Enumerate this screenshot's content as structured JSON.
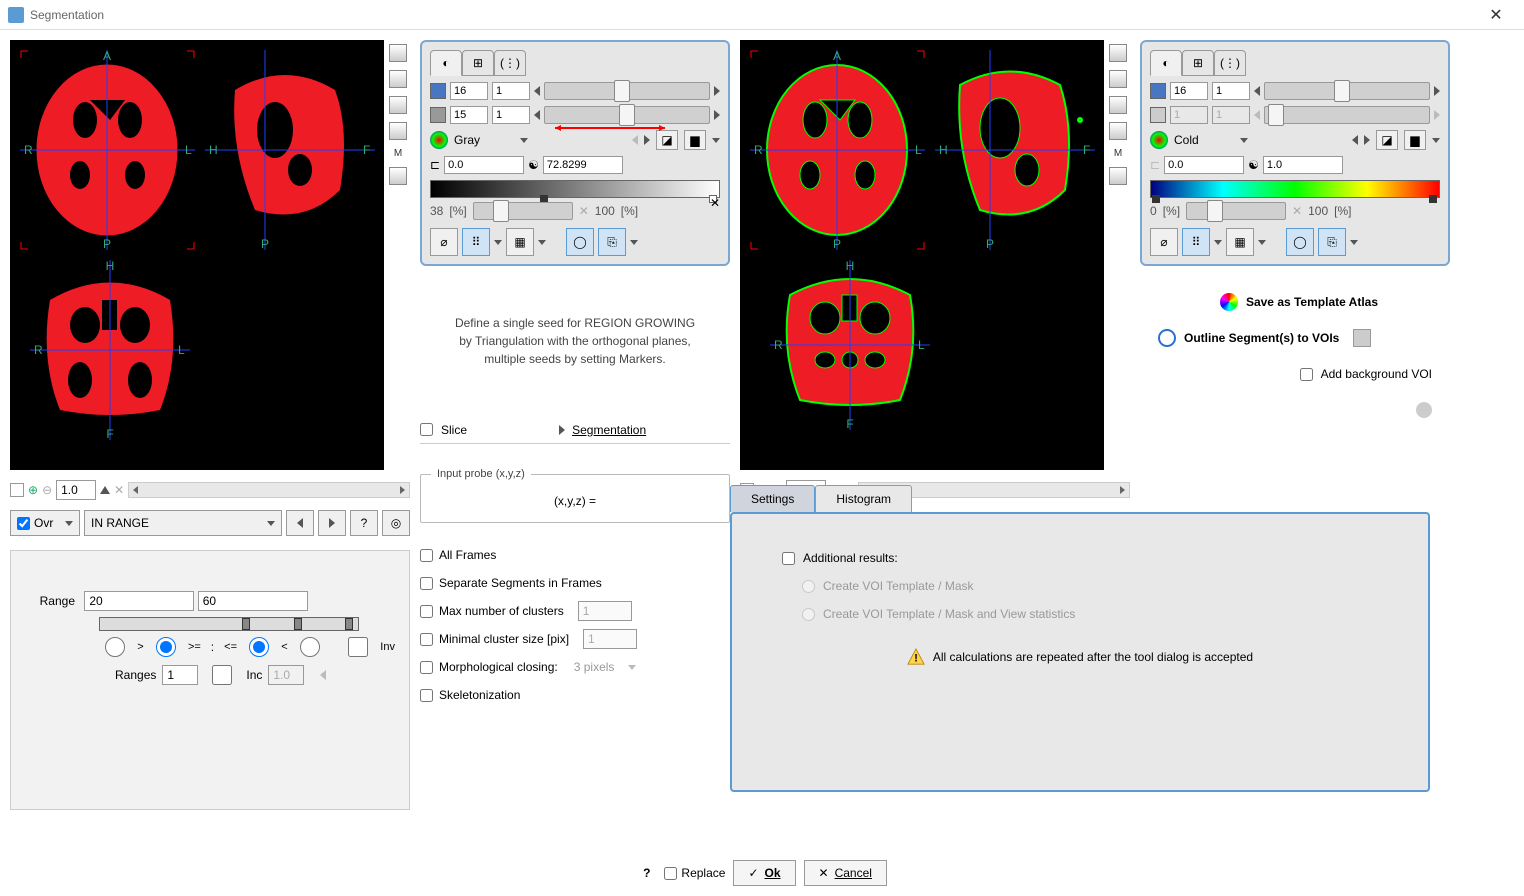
{
  "window": {
    "title": "Segmentation"
  },
  "panel_left": {
    "row1_a": "16",
    "row1_b": "1",
    "row2_a": "15",
    "row2_b": "1",
    "colormap": "Gray",
    "lo": "0.0",
    "hi": "72.8299",
    "pct_lo": "38",
    "pct_hi": "100",
    "pct_unit": "[%]"
  },
  "panel_right": {
    "row1_a": "16",
    "row1_b": "1",
    "row2_a": "1",
    "row2_b": "1",
    "colormap": "Cold",
    "lo": "0.0",
    "hi": "1.0",
    "pct_lo": "0",
    "pct_hi": "100",
    "pct_unit": "[%]"
  },
  "hint": {
    "line1": "Define a single seed for REGION GROWING",
    "line2": "by Triangulation with the orthogonal planes,",
    "line3": "multiple seeds by setting Markers."
  },
  "zoom": {
    "value": "1.0"
  },
  "ovr": {
    "label": "Ovr",
    "mode": "IN RANGE"
  },
  "range": {
    "label": "Range",
    "lo": "20",
    "hi": "60",
    "ranges_label": "Ranges",
    "count": "1",
    "inc_label": "Inc",
    "inc_value": "1.0",
    "inv_label": "Inv"
  },
  "slice": {
    "label": "Slice",
    "seg": "Segmentation"
  },
  "probe": {
    "legend": "Input probe (x,y,z)",
    "eq": "(x,y,z) ="
  },
  "opts": {
    "all_frames": "All Frames",
    "sep": "Separate Segments in Frames",
    "maxc": "Max number of clusters",
    "minc": "Minimal cluster size [pix]",
    "morph": "Morphological closing:",
    "morph_val": "3 pixels",
    "skel": "Skeletonization",
    "one": "1"
  },
  "tabs": {
    "settings": "Settings",
    "histogram": "Histogram"
  },
  "settings": {
    "addl": "Additional results:",
    "voi1": "Create VOI Template / Mask",
    "voi2": "Create VOI Template / Mask and View statistics",
    "warn": "All calculations are repeated after the tool dialog is accepted"
  },
  "actions": {
    "save_atlas": "Save as Template Atlas",
    "outline": "Outline Segment(s) to VOIs",
    "addbg": "Add background VOI"
  },
  "bottom": {
    "replace": "Replace",
    "ok": "Ok",
    "cancel": "Cancel"
  }
}
